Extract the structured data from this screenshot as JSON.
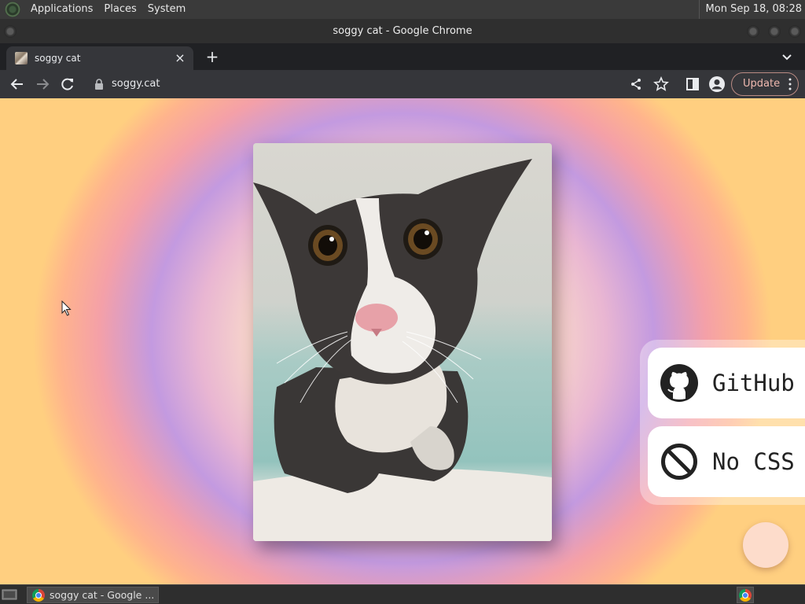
{
  "top_panel": {
    "menus": [
      "Applications",
      "Places",
      "System"
    ],
    "clock": "Mon Sep 18, 08:28"
  },
  "window": {
    "title": "soggy cat - Google Chrome"
  },
  "browser": {
    "tab": {
      "title": "soggy cat",
      "close": "×"
    },
    "new_tab": "+",
    "url": "soggy.cat",
    "update_label": "Update"
  },
  "page": {
    "photo_alt": "soggy cat",
    "links": [
      {
        "label": "GitHub",
        "icon": "github-icon"
      },
      {
        "label": "No CSS",
        "icon": "no-entry-icon"
      }
    ]
  },
  "taskbar": {
    "task_label": "soggy cat - Google ..."
  },
  "colors": {
    "tab_strip": "#202124",
    "toolbar": "#35363a",
    "update_border": "#b98a83",
    "fab": "#fddccb"
  }
}
